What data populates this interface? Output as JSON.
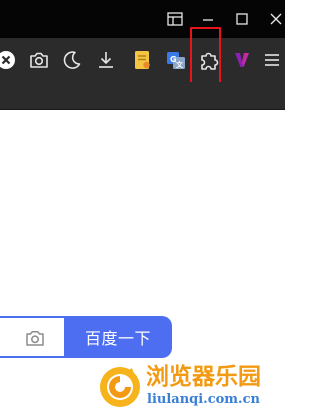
{
  "window_controls": {
    "icons": [
      "tab-layout-icon",
      "minimize-icon",
      "maximize-icon",
      "close-icon"
    ]
  },
  "toolbar": {
    "icons": [
      "close-circle-icon",
      "camera-icon",
      "moon-icon",
      "download-icon",
      "notes-extension-icon",
      "translate-extension-icon",
      "puzzle-extensions-icon",
      "v-extension-icon",
      "menu-icon"
    ],
    "highlighted": "puzzle-extensions-icon",
    "highlight_color": "#e8141b"
  },
  "search": {
    "button_label": "百度一下",
    "accent_color": "#4e6ef2"
  },
  "watermark": {
    "name": "浏览器乐园",
    "domain": "liulanqi.com.cn",
    "name_color": "#f39a12",
    "domain_color": "#3a7fd6"
  }
}
